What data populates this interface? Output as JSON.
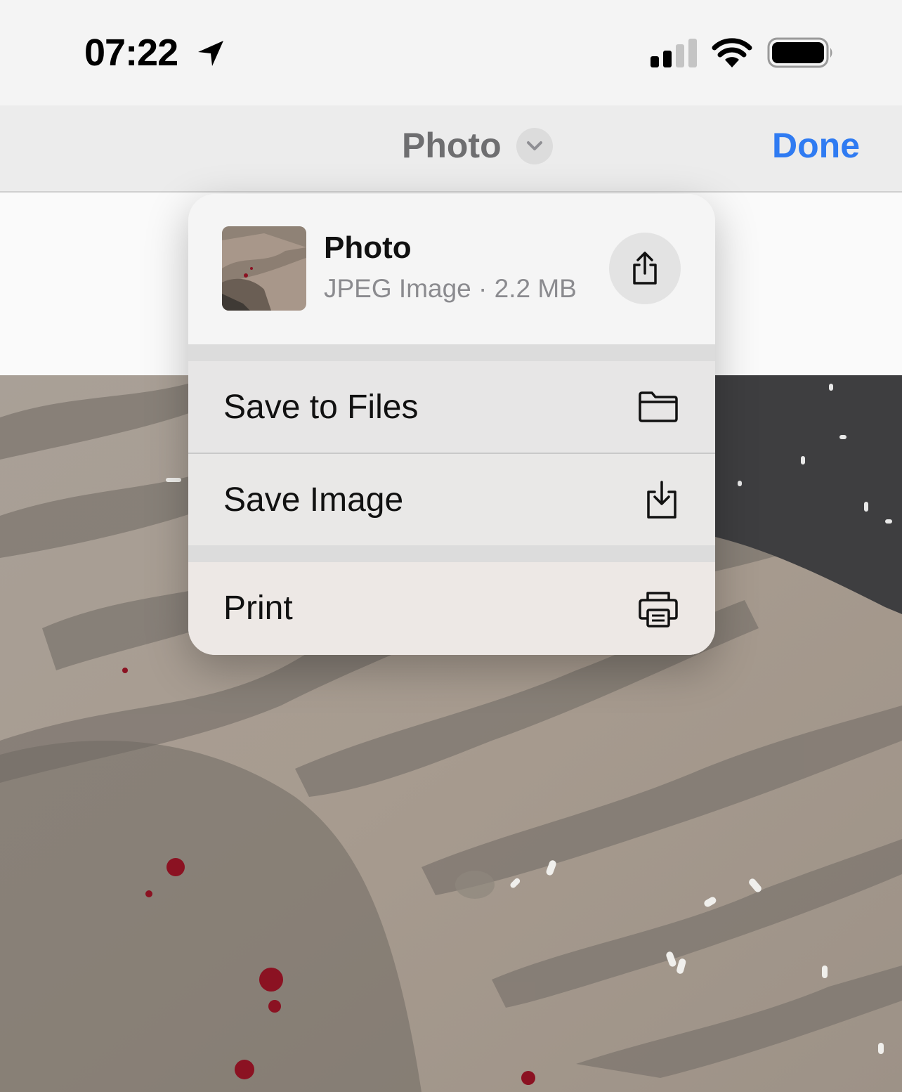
{
  "status_bar": {
    "time": "07:22",
    "icons": [
      "location-arrow-icon",
      "cellular-signal-icon",
      "wifi-icon",
      "battery-icon"
    ]
  },
  "nav": {
    "title": "Photo",
    "done_label": "Done",
    "accent_color": "#2f7bf2"
  },
  "menu": {
    "file_name": "Photo",
    "file_meta": "JPEG Image · 2.2 MB",
    "items": [
      {
        "label": "Save to Files",
        "icon": "folder-icon"
      },
      {
        "label": "Save Image",
        "icon": "download-icon"
      },
      {
        "label": "Print",
        "icon": "printer-icon"
      }
    ]
  }
}
